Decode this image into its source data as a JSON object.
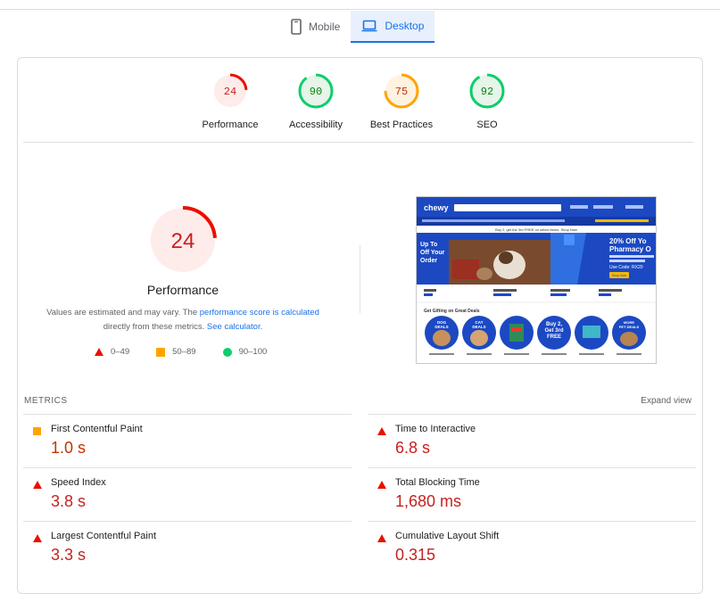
{
  "tabs": {
    "mobile": "Mobile",
    "desktop": "Desktop"
  },
  "gauges": [
    {
      "score": 24,
      "label": "Performance",
      "status": "fail"
    },
    {
      "score": 90,
      "label": "Accessibility",
      "status": "pass"
    },
    {
      "score": 75,
      "label": "Best Practices",
      "status": "average"
    },
    {
      "score": 92,
      "label": "SEO",
      "status": "pass"
    }
  ],
  "summary": {
    "score": "24",
    "title": "Performance",
    "note_prefix": "Values are estimated and may vary. The ",
    "note_link1": "performance score is calculated",
    "note_middle": " directly from these metrics. ",
    "note_link2": "See calculator."
  },
  "legend": {
    "fail": "0–49",
    "average": "50–89",
    "pass": "90–100"
  },
  "metrics": {
    "heading": "METRICS",
    "expand": "Expand view",
    "left": [
      {
        "label": "First Contentful Paint",
        "value": "1.0 s",
        "status": "average"
      },
      {
        "label": "Speed Index",
        "value": "3.8 s",
        "status": "fail"
      },
      {
        "label": "Largest Contentful Paint",
        "value": "3.3 s",
        "status": "fail"
      }
    ],
    "right": [
      {
        "label": "Time to Interactive",
        "value": "6.8 s",
        "status": "fail"
      },
      {
        "label": "Total Blocking Time",
        "value": "1,680 ms",
        "status": "fail"
      },
      {
        "label": "Cumulative Layout Shift",
        "value": "0.315",
        "status": "fail"
      }
    ]
  },
  "preview": {
    "logo": "chewy",
    "banner": "Buy 2, get the 3rd FREE on select items. Shop Now",
    "promo_line1": "20% Off Yo",
    "promo_line2": "Pharmacy O",
    "promo_small": "We handle vet approval & deliver straight to your door",
    "promo_code": "Use Code: RX20",
    "promo_btn": "Shop Now",
    "hero_text": "Up To\nOff Your\nOrder",
    "deals_title": "Get Gifting on Great Deals",
    "deals": [
      "DOG DEALS",
      "CAT DEALS",
      "",
      "Buy 2, Get 3rd FREE",
      "",
      "MORE PET DEALS"
    ]
  },
  "colors": {
    "fail": "#eb0f00",
    "fail_bg": "#fdecea",
    "average": "#e67700",
    "average_marker": "#ffa400",
    "average_bg": "#fff3e0",
    "pass": "#0cce6b",
    "pass_text": "#008800",
    "pass_bg": "#e6f4ea",
    "fail_text": "#c5221f",
    "link": "#1a73e8",
    "chewy_blue": "#1c49c2"
  }
}
